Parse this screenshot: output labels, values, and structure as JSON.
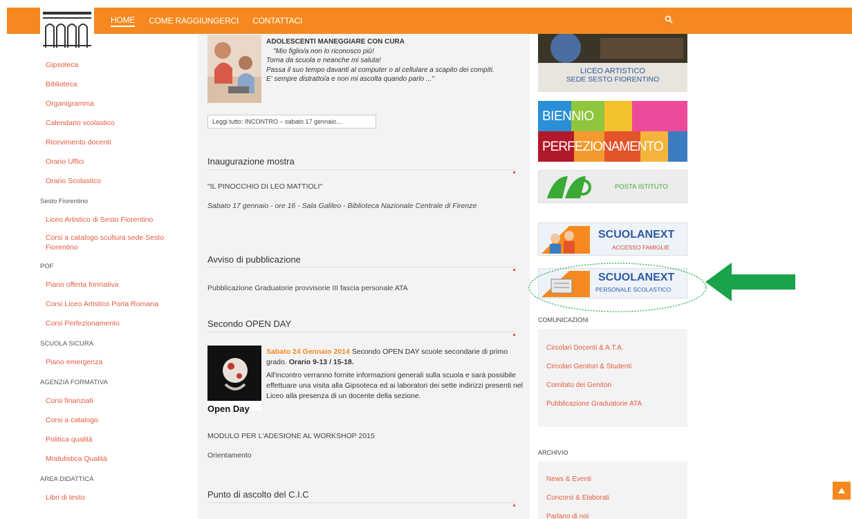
{
  "nav": {
    "items": [
      "HOME",
      "COME RAGGIUNGERCI",
      "CONTATTACI"
    ],
    "search_icon": "search-icon"
  },
  "sidebar": {
    "top_links": [
      "Gipsoteca",
      "Biblioteca",
      "Organigramma",
      "Calendario scolastico",
      "Ricevimento docenti",
      "Orario Uffici",
      "Orario Scolastico"
    ],
    "groups": [
      {
        "title": "Sesto Fiorentino",
        "links": [
          "Liceo Artistico di Sesto Fiorentino",
          "Corsi a catalogo scultura sede Sesto Fiorentino"
        ]
      },
      {
        "title": "POF",
        "links": [
          "Piano offerta formativa",
          "Corsi Liceo Artistico Porta Romana",
          "Corsi Perfezionamento"
        ]
      },
      {
        "title": "SCUOLA SICURA",
        "links": [
          "Piano emergenza"
        ]
      },
      {
        "title": "AGENZIA FORMATIVA",
        "links": [
          "Corsi finanziati",
          "Corsi a catalogo",
          "Politica qualità",
          "Modulistica Qualità"
        ]
      },
      {
        "title": "AREA DIDATTICA",
        "links": [
          "Libri di testo"
        ]
      }
    ]
  },
  "article1": {
    "title": "ADOLESCENTI MANEGGIARE CON CURA",
    "line1": "\"Mio figlio/a non lo riconosco più!",
    "line2": "Torna da scuola e neanche mi saluta!",
    "line3": "Passa il suo tempo davanti al computer o al cellulare a scapito dei compiti.",
    "line4": "E' sempre distratto/a e non mi ascolta quando parlo ...\"",
    "readmore": "Leggi tutto: INCONTRO – sabato 17 gennaio..."
  },
  "section_mostra": {
    "title": "Inaugurazione mostra",
    "link": "\"IL PINOCCHIO DI LEO MATTIOLI\"",
    "text": "Sabato 17 gennaio - ore 16 - Sala Galileo - Biblioteca Nazionale Centrale di Firenze"
  },
  "section_avviso": {
    "title": "Avviso di pubblicazione",
    "link": "Pubblicazione Graduatorie provvisorie III fascia personale ATA"
  },
  "section_openday": {
    "title": "Secondo OPEN DAY",
    "img_label": "Open Day",
    "date": "Sabato 24 Gennaio 2014",
    "intro": " Secondo OPEN DAY scuole secondarie di primo grado. ",
    "orario": "Orario 9-13 / 15-18.",
    "body": "All'incontro verranno fornite informazioni generali sulla scuola e sarà possibile effettuare una visita alla Gipsoteca ed ai laboratori dei sette indirizzi presenti nel Liceo alla presenza di un docente della sezione.",
    "link1": "MODULO PER L'ADESIONE AL WORKSHOP 2015",
    "link2": "Orientamento"
  },
  "section_cic": {
    "title": "Punto di ascolto del C.I.C"
  },
  "right": {
    "liceo_line1": "LICEO ARTISTICO",
    "liceo_line2": "SEDE SESTO FIORENTINO",
    "biennio_word1": "BIENNIO",
    "biennio_word2": "PERFEZIONAMENTO",
    "posta": "POSTA ISTITUTO",
    "scuolanext1_title": "SCUOLANEXT",
    "scuolanext1_sub": "ACCESSO FAMIGLIE",
    "scuolanext2_title": "SCUOLANEXT",
    "scuolanext2_sub": "PERSONALE SCOLASTICO",
    "comunicazioni_title": "COMUNICAZIONI",
    "comunicazioni": [
      "Circolari Docenti & A.T.A.",
      "Circolari Genitori & Studenti",
      "Comitato dei Genitori",
      "Pubblicazione Graduatorie ATA"
    ],
    "archivio_title": "ARCHIVIO",
    "archivio": [
      "News & Eventi",
      "Concorsi & Elaborati",
      "Parlano di noi"
    ]
  },
  "colors": {
    "accent": "#f5891f",
    "link": "#e45b3f",
    "annotation_green": "#1aa34a"
  }
}
